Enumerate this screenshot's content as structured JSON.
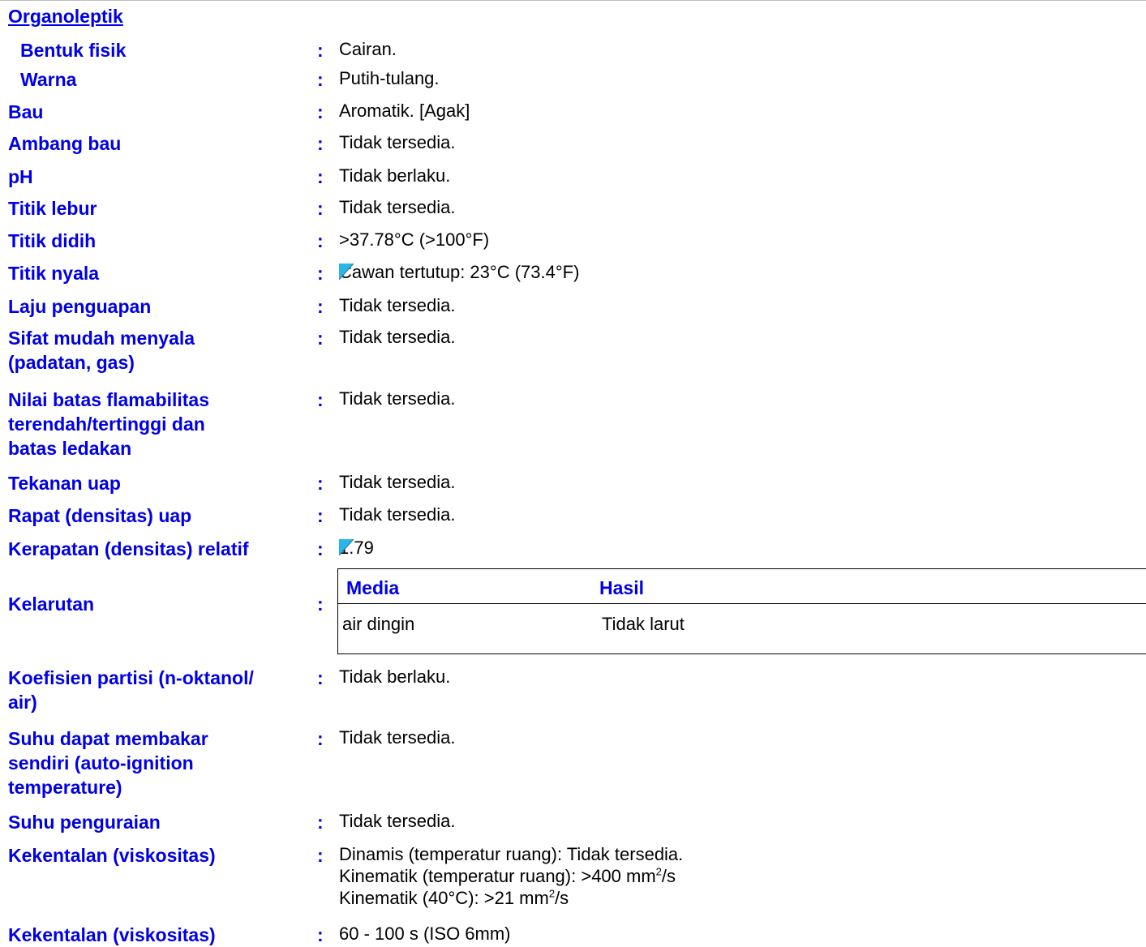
{
  "section_heading": "Organoleptik",
  "colon": ":",
  "properties": [
    {
      "label": "Bentuk fisik",
      "value": "Cairan."
    },
    {
      "label": "Warna",
      "value": "Putih-tulang."
    },
    {
      "label": "Bau",
      "value": "Aromatik. [Agak]"
    },
    {
      "label": "Ambang bau",
      "value": "Tidak tersedia."
    },
    {
      "label": "pH",
      "value": "Tidak berlaku."
    },
    {
      "label": "Titik lebur",
      "value": "Tidak tersedia."
    },
    {
      "label": "Titik didih",
      "value": ">37.78°C (>100°F)"
    },
    {
      "label": "Titik nyala",
      "value": "Cawan tertutup: 23°C (73.4°F)"
    },
    {
      "label": "Laju penguapan",
      "value": "Tidak tersedia."
    },
    {
      "label_lines": [
        "Sifat mudah menyala",
        "(padatan, gas)"
      ],
      "value": "Tidak tersedia."
    },
    {
      "label_lines": [
        "Nilai batas flamabilitas",
        "terendah/tertinggi dan",
        "batas ledakan"
      ],
      "value": "Tidak tersedia."
    },
    {
      "label": "Tekanan uap",
      "value": "Tidak tersedia."
    },
    {
      "label": "Rapat (densitas) uap",
      "value": "Tidak tersedia."
    },
    {
      "label": "Kerapatan (densitas) relatif",
      "value": "1.79"
    },
    {
      "label": "Kelarutan"
    },
    {
      "label_lines": [
        "Koefisien partisi (n-oktanol/",
        "air)"
      ],
      "value": "Tidak berlaku."
    },
    {
      "label_lines": [
        "Suhu dapat membakar",
        "sendiri (auto-ignition",
        "temperature)"
      ],
      "value": "Tidak tersedia."
    },
    {
      "label": "Suhu penguraian",
      "value": "Tidak tersedia."
    },
    {
      "label": "Kekentalan (viskositas)",
      "value_lines": [
        "Dinamis (temperatur ruang): Tidak tersedia.",
        "Kinematik (temperatur ruang): >400 mm",
        "/s",
        "Kinematik (40°C): >21 mm",
        "/s"
      ],
      "superscript": "2"
    },
    {
      "label": "Kekentalan (viskositas)",
      "value": "60 - 100 s (ISO 6mm)"
    }
  ],
  "solubility_table": {
    "headers": [
      "Media",
      "Hasil"
    ],
    "rows": [
      [
        "air dingin",
        "Tidak larut"
      ]
    ]
  },
  "colors": {
    "label_blue": "#0000e6",
    "marker_cyan": "#29b6e8"
  }
}
